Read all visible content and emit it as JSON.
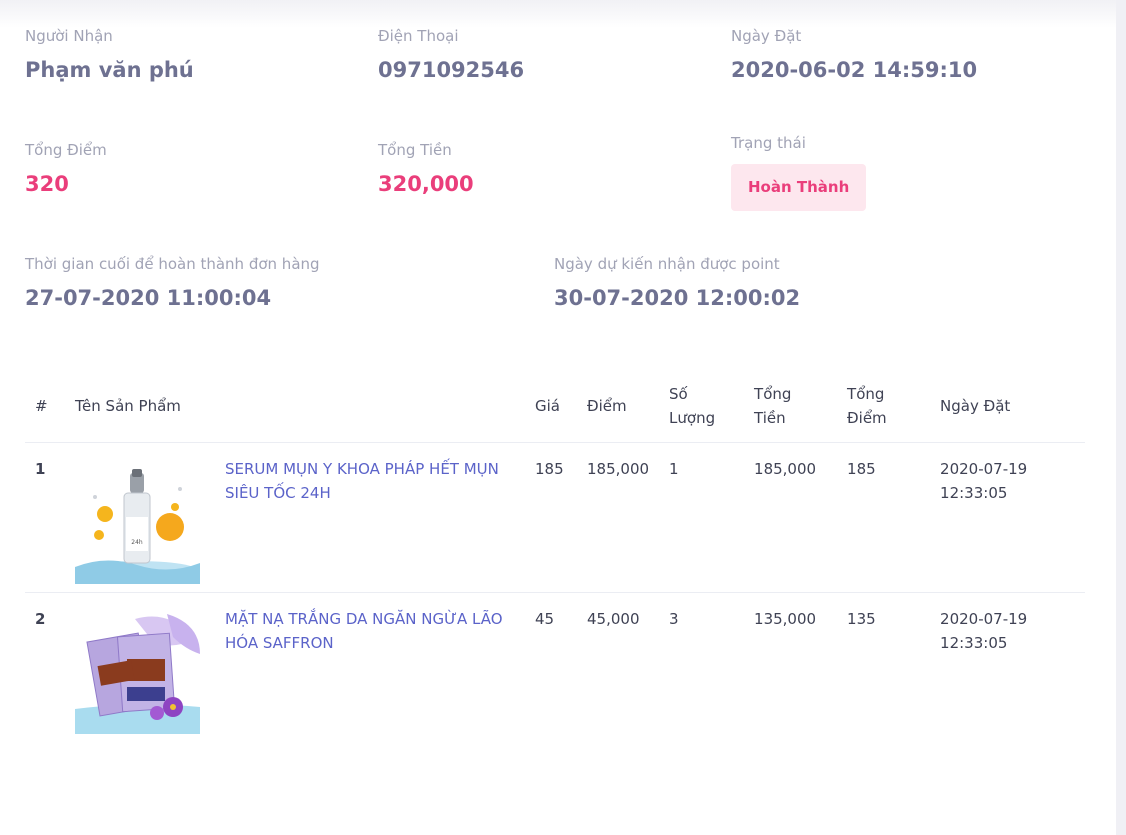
{
  "recipient": {
    "label": "Người Nhận",
    "value": "Phạm văn phú"
  },
  "phone": {
    "label": "Điện Thoại",
    "value": "0971092546"
  },
  "order_date": {
    "label": "Ngày Đặt",
    "value": "2020-06-02 14:59:10"
  },
  "total_points": {
    "label": "Tổng Điểm",
    "value": "320"
  },
  "total_amount": {
    "label": "Tổng Tiền",
    "value": "320,000"
  },
  "status": {
    "label": "Trạng thái",
    "value": "Hoàn Thành"
  },
  "deadline": {
    "label": "Thời gian cuối để hoàn thành đơn hàng",
    "value": "27-07-2020 11:00:04"
  },
  "expected_point_date": {
    "label": "Ngày dự kiến nhận được point",
    "value": "30-07-2020 12:00:02"
  },
  "table": {
    "headers": {
      "index": "#",
      "product": "Tên Sản Phẩm",
      "price": "Giá",
      "points": "Điểm",
      "quantity": "Số Lượng",
      "total_amount": "Tổng Tiền",
      "total_points": "Tổng Điểm",
      "date": "Ngày Đặt"
    },
    "rows": [
      {
        "index": "1",
        "name": "SERUM MỤN Y KHOA PHÁP HẾT MỤN SIÊU TỐC 24H",
        "price": "185",
        "points": "185,000",
        "quantity": "1",
        "total_amount": "185,000",
        "total_points": "185",
        "date": "2020-07-19 12:33:05",
        "image": "serum-bottle-product-image"
      },
      {
        "index": "2",
        "name": "MẶT NẠ TRẮNG DA NGĂN NGỪA LÃO HÓA SAFFRON",
        "price": "45",
        "points": "45,000",
        "quantity": "3",
        "total_amount": "135,000",
        "total_points": "135",
        "date": "2020-07-19 12:33:05",
        "image": "saffron-mask-product-image"
      }
    ]
  },
  "colors": {
    "accent_pink": "#ea3e7b",
    "badge_bg": "#fde7ee",
    "link": "#5b63c9",
    "value_text": "#6e7191",
    "label_text": "#a1a3b5"
  }
}
